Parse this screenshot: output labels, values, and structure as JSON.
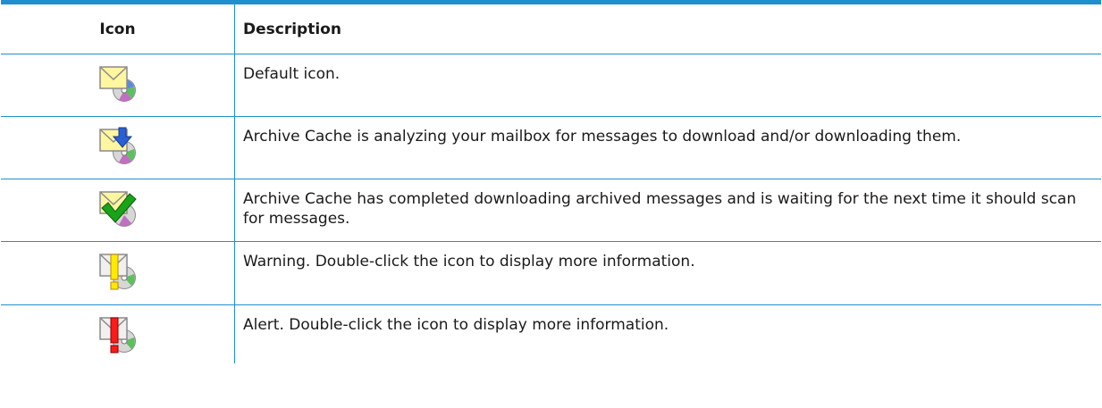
{
  "table": {
    "header": {
      "icon": "Icon",
      "description": "Description"
    },
    "rows": [
      {
        "icon": "envelope-disc-icon",
        "description": "Default icon."
      },
      {
        "icon": "envelope-download-arrow-icon",
        "description": "Archive Cache is analyzing your mailbox for messages to download and/or downloading them."
      },
      {
        "icon": "envelope-checkmark-icon",
        "description": "Archive Cache has completed downloading archived messages and is waiting for the next time it should scan for messages."
      },
      {
        "icon": "envelope-warning-icon",
        "description": "Warning. Double-click the icon to display more information."
      },
      {
        "icon": "envelope-alert-icon",
        "description": "Alert. Double-click the icon to display more information."
      }
    ]
  },
  "colors": {
    "rule": "#1f8fd0",
    "warning": "#ffea00",
    "alert": "#ff1a1a",
    "check": "#19a319",
    "arrow": "#2a5fd8"
  }
}
